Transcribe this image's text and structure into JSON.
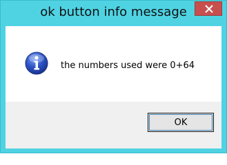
{
  "window": {
    "title": "ok button info message",
    "close_glyph": "✕"
  },
  "dialog": {
    "icon": "info-icon",
    "message": "the numbers used were 0+64"
  },
  "buttons": {
    "ok_label": "OK"
  },
  "colors": {
    "frame": "#4fd3e3",
    "close_button": "#c7504f",
    "button_area": "#f0f0f0",
    "info_icon": "#2d54c6"
  }
}
